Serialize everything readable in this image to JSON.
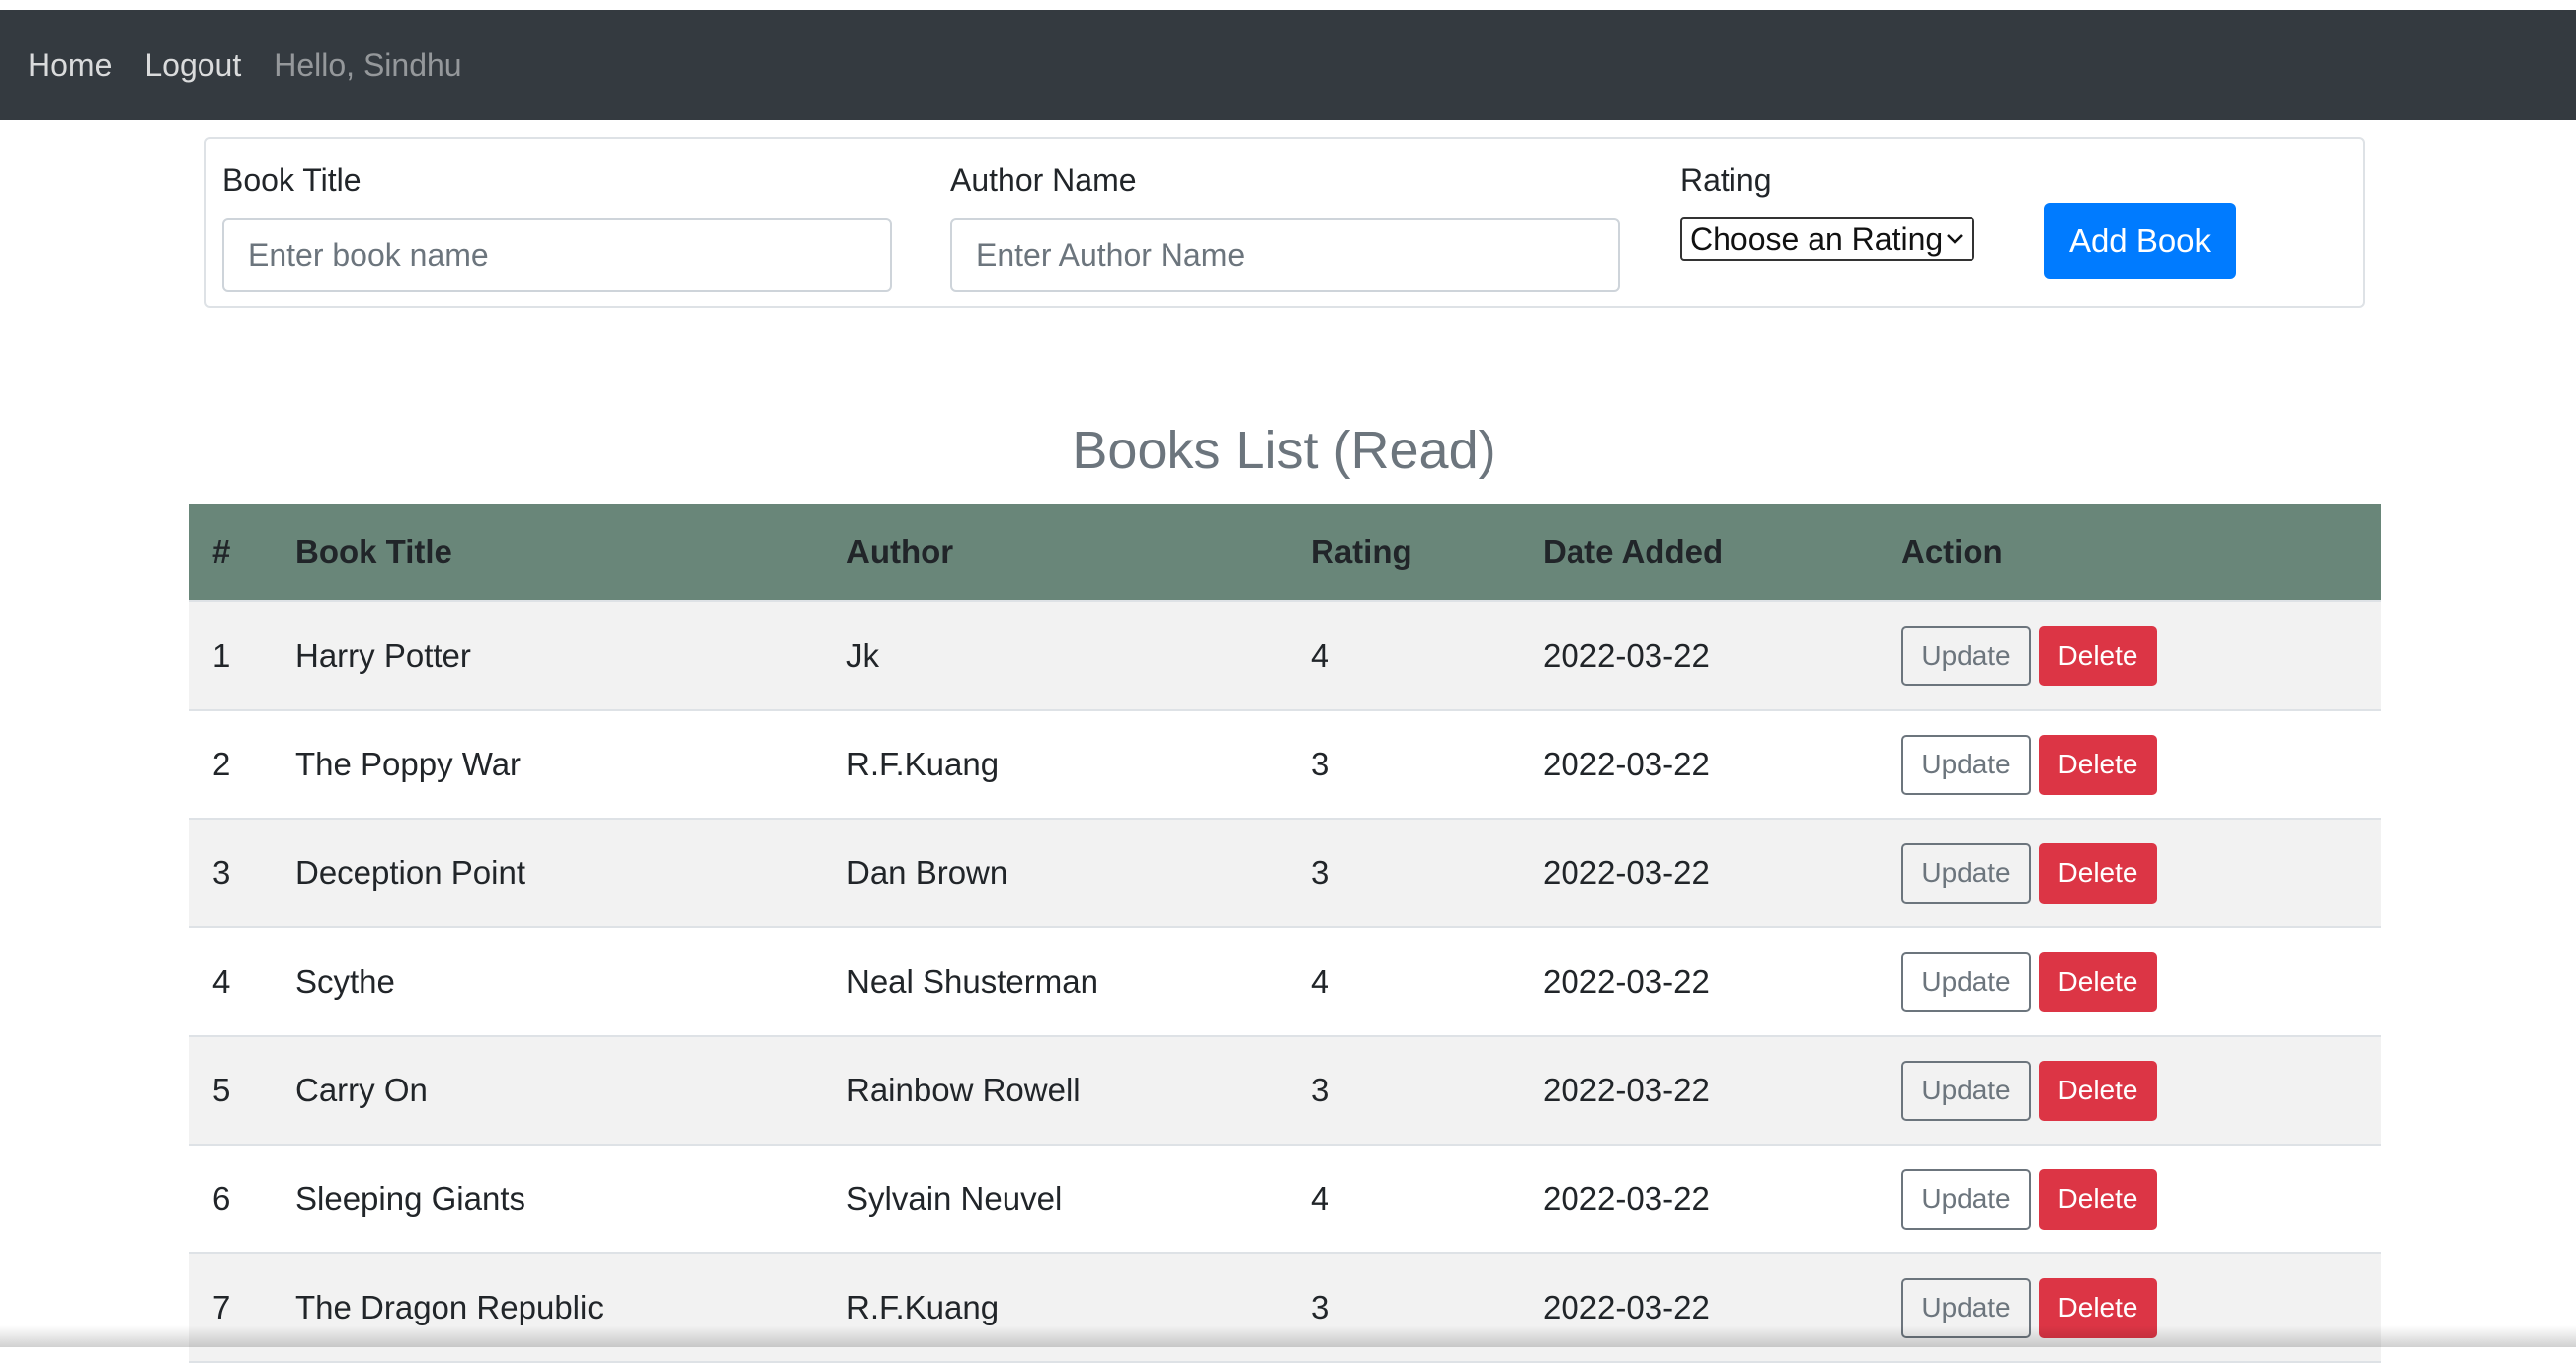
{
  "navbar": {
    "home_label": "Home",
    "logout_label": "Logout",
    "greeting": "Hello, Sindhu"
  },
  "form": {
    "title_label": "Book Title",
    "title_placeholder": "Enter book name",
    "author_label": "Author Name",
    "author_placeholder": "Enter Author Name",
    "rating_label": "Rating",
    "rating_selected": "Choose an Rating",
    "add_button": "Add Book"
  },
  "list": {
    "heading": "Books List (Read)",
    "columns": [
      "#",
      "Book Title",
      "Author",
      "Rating",
      "Date Added",
      "Action"
    ],
    "update_label": "Update",
    "delete_label": "Delete",
    "rows": [
      {
        "num": "1",
        "title": "Harry Potter",
        "author": "Jk",
        "rating": "4",
        "date": "2022-03-22"
      },
      {
        "num": "2",
        "title": "The Poppy War",
        "author": "R.F.Kuang",
        "rating": "3",
        "date": "2022-03-22"
      },
      {
        "num": "3",
        "title": "Deception Point",
        "author": "Dan Brown",
        "rating": "3",
        "date": "2022-03-22"
      },
      {
        "num": "4",
        "title": "Scythe",
        "author": "Neal Shusterman",
        "rating": "4",
        "date": "2022-03-22"
      },
      {
        "num": "5",
        "title": "Carry On",
        "author": "Rainbow Rowell",
        "rating": "3",
        "date": "2022-03-22"
      },
      {
        "num": "6",
        "title": "Sleeping Giants",
        "author": "Sylvain Neuvel",
        "rating": "4",
        "date": "2022-03-22"
      },
      {
        "num": "7",
        "title": "The Dragon Republic",
        "author": "R.F.Kuang",
        "rating": "3",
        "date": "2022-03-22"
      }
    ]
  },
  "colors": {
    "navbar": "#343a40",
    "header_row": "#698679",
    "primary": "#007bff",
    "danger": "#dc3545"
  }
}
